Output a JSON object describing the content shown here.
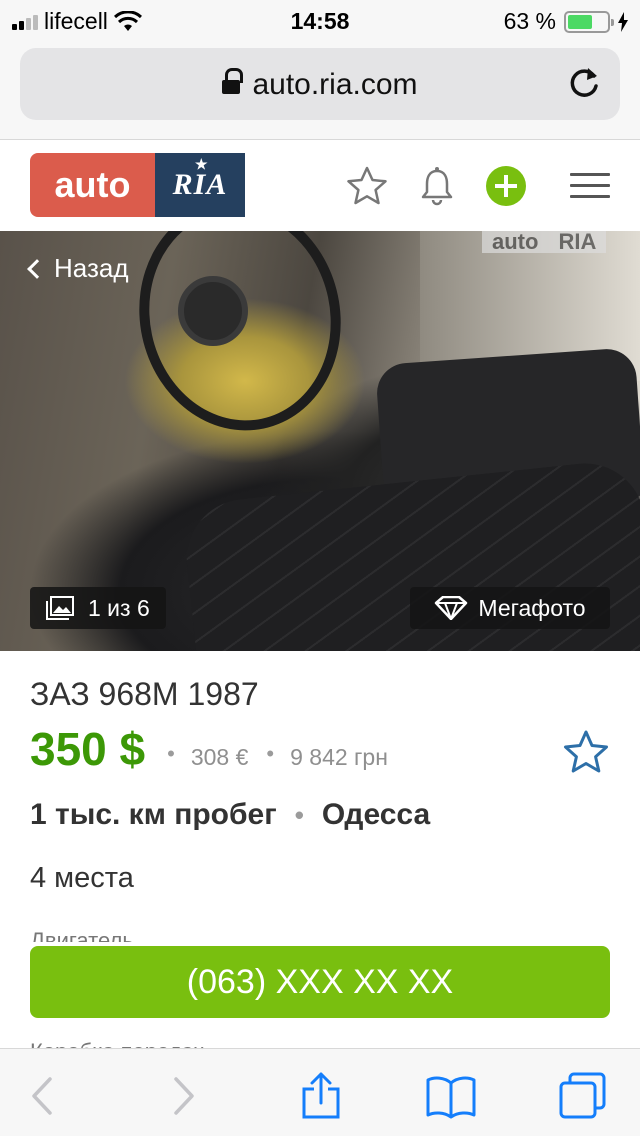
{
  "status_bar": {
    "carrier": "lifecell",
    "time": "14:58",
    "battery": "63 %",
    "battery_level": 0.63
  },
  "browser": {
    "url": "auto.ria.com"
  },
  "header": {
    "logo_auto": "auto",
    "logo_ria": "RIA",
    "icons": [
      "star-icon",
      "bell-icon",
      "plus-icon",
      "menu-icon"
    ],
    "accent_color": "#79bf0f"
  },
  "photo": {
    "back_label": "Назад",
    "counter": "1 из 6",
    "megaphoto_label": "Мегафото",
    "watermark_auto": "auto",
    "watermark_ria": "RIA"
  },
  "listing": {
    "title": "ЗАЗ 968М 1987",
    "price_usd": "350 $",
    "price_eur": "308 €",
    "price_uah": "9 842 грн",
    "mileage": "1 тыс. км пробег",
    "city": "Одесса",
    "seats": "4 места",
    "engine_label": "Двигатель",
    "gearbox_label": "Коробка передач",
    "phone": "(063) XXX XX XX",
    "price_color": "#3c9806"
  },
  "toolbar": {
    "icons": [
      "back-arrow-icon",
      "forward-arrow-icon",
      "share-icon",
      "bookmarks-icon",
      "tabs-icon"
    ]
  }
}
